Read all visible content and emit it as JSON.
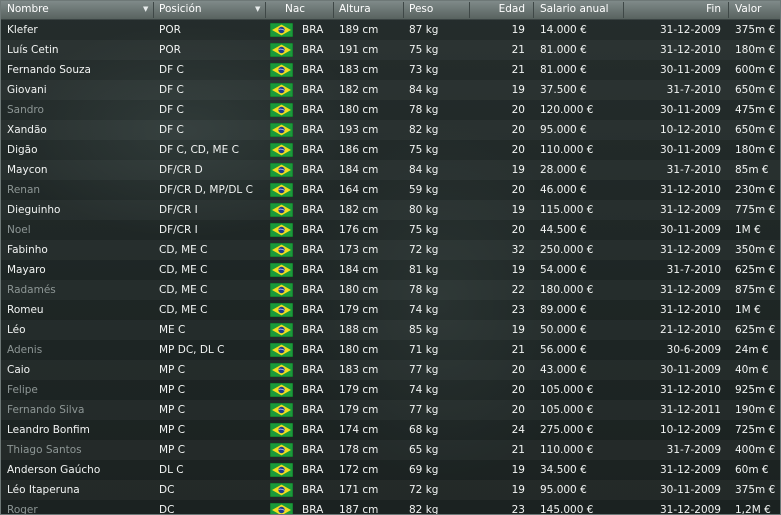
{
  "columns": {
    "nombre": "Nombre",
    "posicion": "Posición",
    "nac": "Nac",
    "altura": "Altura",
    "peso": "Peso",
    "edad": "Edad",
    "salario": "Salario anual",
    "fin": "Fin",
    "valor": "Valor"
  },
  "icons": {
    "sort": "sort-arrow-icon",
    "flag": "brazil-flag-icon"
  },
  "colors": {
    "header": "#6d7776",
    "text": "#f2f4f3",
    "dimmed_name": "#8d9695",
    "background": "#1e2625"
  },
  "players": [
    {
      "name": "Klefer",
      "pos": "POR",
      "nac": "BRA",
      "height": "189 cm",
      "weight": "87 kg",
      "age": "19",
      "salary": "14.000 €",
      "end": "31-12-2009",
      "value": "375m €",
      "dim": false
    },
    {
      "name": "Luís Cetin",
      "pos": "POR",
      "nac": "BRA",
      "height": "191 cm",
      "weight": "75 kg",
      "age": "21",
      "salary": "81.000 €",
      "end": "31-12-2010",
      "value": "180m €",
      "dim": false
    },
    {
      "name": "Fernando Souza",
      "pos": "DF C",
      "nac": "BRA",
      "height": "183 cm",
      "weight": "73 kg",
      "age": "21",
      "salary": "81.000 €",
      "end": "30-11-2009",
      "value": "600m €",
      "dim": false
    },
    {
      "name": "Giovani",
      "pos": "DF C",
      "nac": "BRA",
      "height": "182 cm",
      "weight": "84 kg",
      "age": "19",
      "salary": "37.500 €",
      "end": "31-7-2010",
      "value": "650m €",
      "dim": false
    },
    {
      "name": "Sandro",
      "pos": "DF C",
      "nac": "BRA",
      "height": "180 cm",
      "weight": "78 kg",
      "age": "20",
      "salary": "120.000 €",
      "end": "30-11-2009",
      "value": "475m €",
      "dim": true
    },
    {
      "name": "Xandão",
      "pos": "DF C",
      "nac": "BRA",
      "height": "193 cm",
      "weight": "82 kg",
      "age": "20",
      "salary": "95.000 €",
      "end": "10-12-2010",
      "value": "650m €",
      "dim": false
    },
    {
      "name": "Digão",
      "pos": "DF C, CD, ME C",
      "nac": "BRA",
      "height": "186 cm",
      "weight": "75 kg",
      "age": "20",
      "salary": "110.000 €",
      "end": "30-11-2009",
      "value": "180m €",
      "dim": false
    },
    {
      "name": "Maycon",
      "pos": "DF/CR D",
      "nac": "BRA",
      "height": "184 cm",
      "weight": "84 kg",
      "age": "19",
      "salary": "28.000 €",
      "end": "31-7-2010",
      "value": "85m €",
      "dim": false
    },
    {
      "name": "Renan",
      "pos": "DF/CR D, MP/DL C",
      "nac": "BRA",
      "height": "164 cm",
      "weight": "59 kg",
      "age": "20",
      "salary": "46.000 €",
      "end": "31-12-2010",
      "value": "230m €",
      "dim": true
    },
    {
      "name": "Dieguinho",
      "pos": "DF/CR I",
      "nac": "BRA",
      "height": "182 cm",
      "weight": "80 kg",
      "age": "19",
      "salary": "115.000 €",
      "end": "31-12-2009",
      "value": "775m €",
      "dim": false
    },
    {
      "name": "Noel",
      "pos": "DF/CR I",
      "nac": "BRA",
      "height": "176 cm",
      "weight": "75 kg",
      "age": "20",
      "salary": "44.500 €",
      "end": "30-11-2009",
      "value": "1M €",
      "dim": true
    },
    {
      "name": "Fabinho",
      "pos": "CD, ME C",
      "nac": "BRA",
      "height": "173 cm",
      "weight": "72 kg",
      "age": "32",
      "salary": "250.000 €",
      "end": "31-12-2009",
      "value": "350m €",
      "dim": false
    },
    {
      "name": "Mayaro",
      "pos": "CD, ME C",
      "nac": "BRA",
      "height": "184 cm",
      "weight": "81 kg",
      "age": "19",
      "salary": "54.000 €",
      "end": "31-7-2010",
      "value": "625m €",
      "dim": false
    },
    {
      "name": "Radamés",
      "pos": "CD, ME C",
      "nac": "BRA",
      "height": "180 cm",
      "weight": "78 kg",
      "age": "22",
      "salary": "180.000 €",
      "end": "31-12-2009",
      "value": "875m €",
      "dim": true
    },
    {
      "name": "Romeu",
      "pos": "CD, ME C",
      "nac": "BRA",
      "height": "179 cm",
      "weight": "74 kg",
      "age": "23",
      "salary": "89.000 €",
      "end": "31-12-2010",
      "value": "1M €",
      "dim": false
    },
    {
      "name": "Léo",
      "pos": "ME C",
      "nac": "BRA",
      "height": "188 cm",
      "weight": "85 kg",
      "age": "19",
      "salary": "50.000 €",
      "end": "21-12-2010",
      "value": "625m €",
      "dim": false
    },
    {
      "name": "Adenis",
      "pos": "MP DC, DL C",
      "nac": "BRA",
      "height": "180 cm",
      "weight": "71 kg",
      "age": "21",
      "salary": "56.000 €",
      "end": "30-6-2009",
      "value": "24m €",
      "dim": true
    },
    {
      "name": "Caio",
      "pos": "MP C",
      "nac": "BRA",
      "height": "183 cm",
      "weight": "77 kg",
      "age": "20",
      "salary": "43.000 €",
      "end": "30-11-2009",
      "value": "40m €",
      "dim": false
    },
    {
      "name": "Felipe",
      "pos": "MP C",
      "nac": "BRA",
      "height": "179 cm",
      "weight": "74 kg",
      "age": "20",
      "salary": "105.000 €",
      "end": "31-12-2010",
      "value": "925m €",
      "dim": true
    },
    {
      "name": "Fernando Silva",
      "pos": "MP C",
      "nac": "BRA",
      "height": "179 cm",
      "weight": "77 kg",
      "age": "20",
      "salary": "105.000 €",
      "end": "31-12-2011",
      "value": "190m €",
      "dim": true
    },
    {
      "name": "Leandro Bonfim",
      "pos": "MP C",
      "nac": "BRA",
      "height": "174 cm",
      "weight": "68 kg",
      "age": "24",
      "salary": "275.000 €",
      "end": "10-12-2009",
      "value": "725m €",
      "dim": false
    },
    {
      "name": "Thiago Santos",
      "pos": "MP C",
      "nac": "BRA",
      "height": "178 cm",
      "weight": "65 kg",
      "age": "21",
      "salary": "110.000 €",
      "end": "31-7-2009",
      "value": "400m €",
      "dim": true
    },
    {
      "name": "Anderson Gaúcho",
      "pos": "DL C",
      "nac": "BRA",
      "height": "172 cm",
      "weight": "69 kg",
      "age": "19",
      "salary": "34.500 €",
      "end": "31-12-2009",
      "value": "60m €",
      "dim": false
    },
    {
      "name": "Léo Itaperuna",
      "pos": "DC",
      "nac": "BRA",
      "height": "171 cm",
      "weight": "72 kg",
      "age": "19",
      "salary": "95.000 €",
      "end": "30-11-2009",
      "value": "375m €",
      "dim": false
    },
    {
      "name": "Roger",
      "pos": "DC",
      "nac": "BRA",
      "height": "187 cm",
      "weight": "82 kg",
      "age": "23",
      "salary": "145.000 €",
      "end": "31-12-2009",
      "value": "1,2M €",
      "dim": true
    }
  ]
}
